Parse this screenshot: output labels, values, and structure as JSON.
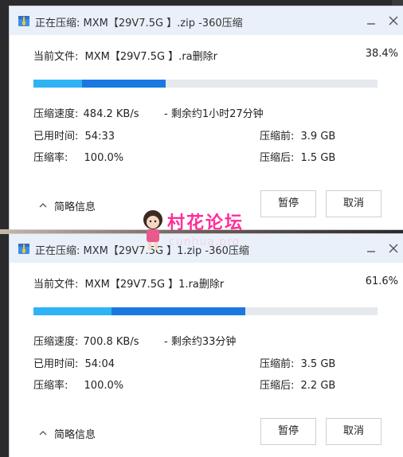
{
  "windows": [
    {
      "title": "正在压缩: MXM【29V7.5G 】.zip -360压缩",
      "current_file_label": "当前文件:",
      "current_file": "MXM【29V7.5G 】.ra删除r",
      "progress_text": "38.4%",
      "progress": 0.384,
      "speed_label": "压缩速度:",
      "speed": "484.2 KB/s",
      "remaining": "- 剩余约1小时27分钟",
      "elapsed_label": "已用时间:",
      "elapsed": "54:33",
      "before_label": "压缩前:",
      "before": "3.9 GB",
      "ratio_label": "压缩率:",
      "ratio": "100.0%",
      "after_label": "压缩后:",
      "after": "1.5 GB",
      "toggle_label": "简略信息",
      "pause_label": "暂停",
      "cancel_label": "取消"
    },
    {
      "title": "正在压缩: MXM【29V7.5G 】1.zip -360压缩",
      "current_file_label": "当前文件:",
      "current_file": "MXM【29V7.5G 】1.ra删除r",
      "progress_text": "61.6%",
      "progress": 0.616,
      "speed_label": "压缩速度:",
      "speed": "700.8 KB/s",
      "remaining": "- 剩余约33分钟",
      "elapsed_label": "已用时间:",
      "elapsed": "54:04",
      "before_label": "压缩前:",
      "before": "3.5 GB",
      "ratio_label": "压缩率:",
      "ratio": "100.0%",
      "after_label": "压缩后:",
      "after": "2.2 GB",
      "toggle_label": "简略信息",
      "pause_label": "暂停",
      "cancel_label": "取消"
    }
  ],
  "watermark": {
    "text": "村花论坛",
    "url": "cunhua.pro",
    "color": "#ff2e9a"
  },
  "colors": {
    "titlebar": "#e9f0f9",
    "bar_light": "#2fb3f5",
    "bar_dark": "#1a78e0",
    "bar_track": "#e5e8ed"
  },
  "icons": {
    "app": "zip-archive-icon",
    "minimize": "minimize-icon",
    "close": "close-icon",
    "toggle": "chevron-up-icon"
  }
}
